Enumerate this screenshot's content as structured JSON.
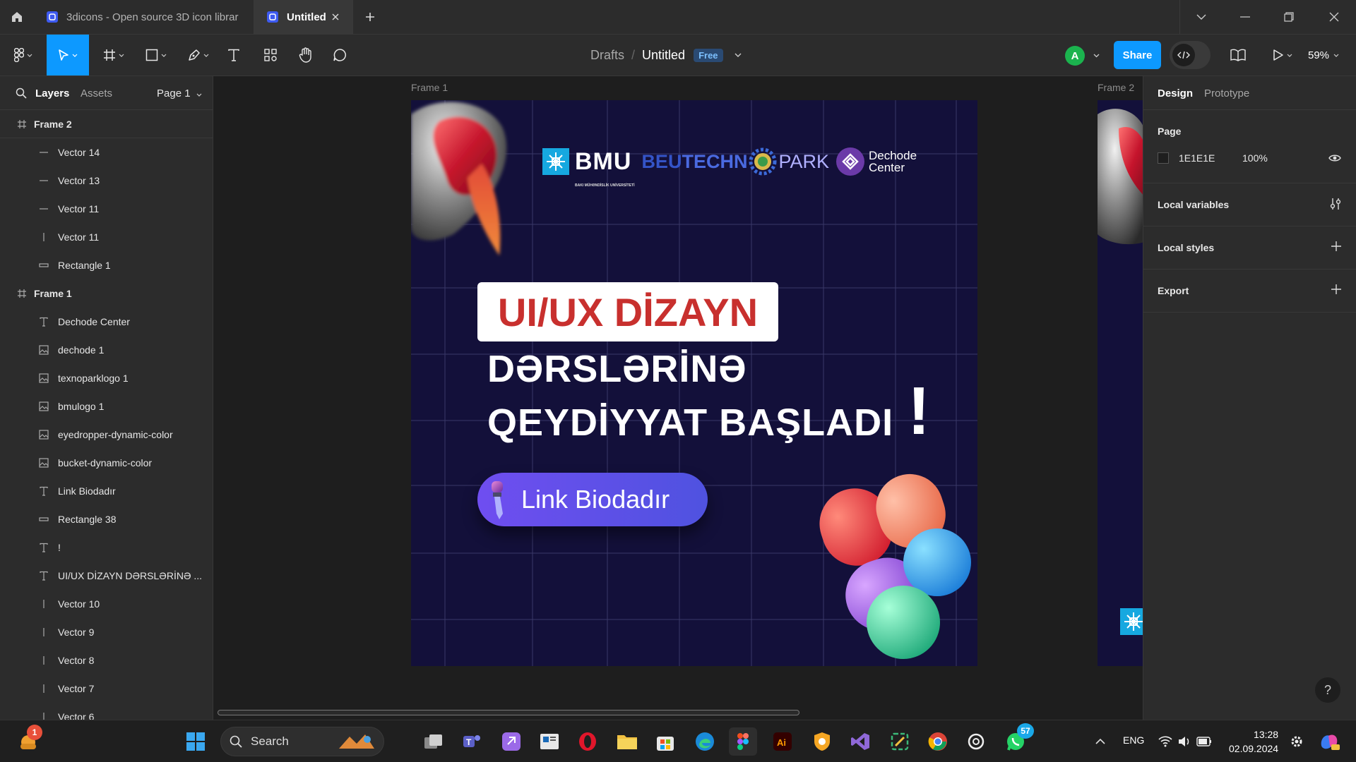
{
  "browser": {
    "tabs": [
      {
        "title": "3dicons - Open source 3D icon librar"
      },
      {
        "title": "Untitled"
      }
    ]
  },
  "toolbar": {
    "breadcrumb_root": "Drafts",
    "separator": "/",
    "file_name": "Untitled",
    "plan_badge": "Free",
    "avatar_initial": "A",
    "share_label": "Share",
    "zoom": "59%"
  },
  "left_panel": {
    "tabs": {
      "layers": "Layers",
      "assets": "Assets"
    },
    "page_selector": "Page 1",
    "layers": [
      {
        "name": "Frame 2",
        "kind": "frame"
      },
      {
        "name": "Vector 14",
        "kind": "line-h"
      },
      {
        "name": "Vector 13",
        "kind": "line-h"
      },
      {
        "name": "Vector 11",
        "kind": "line-h"
      },
      {
        "name": "Vector 11",
        "kind": "line-v"
      },
      {
        "name": "Rectangle 1",
        "kind": "rect"
      },
      {
        "name": "Frame 1",
        "kind": "frame"
      },
      {
        "name": "Dechode Center",
        "kind": "text"
      },
      {
        "name": "dechode 1",
        "kind": "image"
      },
      {
        "name": "texnoparklogo 1",
        "kind": "image"
      },
      {
        "name": "bmulogo 1",
        "kind": "image"
      },
      {
        "name": "eyedropper-dynamic-color",
        "kind": "image"
      },
      {
        "name": "bucket-dynamic-color",
        "kind": "image"
      },
      {
        "name": "Link Biodadır",
        "kind": "text"
      },
      {
        "name": "Rectangle 38",
        "kind": "rect"
      },
      {
        "name": "!",
        "kind": "text"
      },
      {
        "name": "UI/UX DİZAYN DƏRSLƏRİNƏ ...",
        "kind": "text"
      },
      {
        "name": "Vector 10",
        "kind": "line-v"
      },
      {
        "name": "Vector 9",
        "kind": "line-v"
      },
      {
        "name": "Vector 8",
        "kind": "line-v"
      },
      {
        "name": "Vector 7",
        "kind": "line-v"
      },
      {
        "name": "Vector 6",
        "kind": "line-v"
      }
    ]
  },
  "canvas": {
    "frame1_label": "Frame 1",
    "frame2_label": "Frame 2",
    "poster": {
      "bmu_logo_text": "BMU",
      "bmu_subtext": "BAKI MÜHƏNDİSLİK UNİVERSİTETİ",
      "techno_beu": "BEU",
      "techno_techn": "TECHN",
      "techno_park": "PARK",
      "dechode_line1": "Dechode",
      "dechode_line2": "Center",
      "headline": "UI/UX DİZAYN",
      "line2": "DƏRSLƏRİNƏ",
      "line3": "QEYDİYYAT BAŞLADI",
      "exclamation": "!",
      "link_button": "Link Biodadır"
    }
  },
  "right_panel": {
    "tabs": {
      "design": "Design",
      "prototype": "Prototype"
    },
    "page_title": "Page",
    "page_color": "1E1E1E",
    "page_opacity": "100%",
    "sections": [
      "Local variables",
      "Local styles",
      "Export"
    ],
    "help": "?"
  },
  "taskbar": {
    "search_placeholder": "Search",
    "language": "ENG",
    "time": "13:28",
    "date": "02.09.2024",
    "widget_badge": "1",
    "whatsapp_badge": "57"
  },
  "colors": {
    "accent": "#0d99ff",
    "poster_bg": "#13103a",
    "headline_red": "#c8302e",
    "button_purple": "#6f4ef0"
  }
}
